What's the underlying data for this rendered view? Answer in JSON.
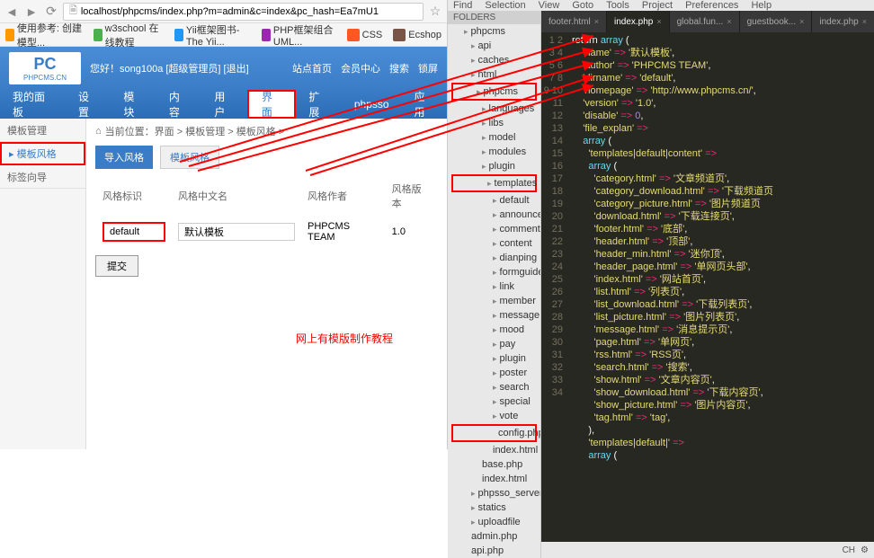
{
  "browser": {
    "url": "localhost/phpcms/index.php?m=admin&c=index&pc_hash=Ea7mU1"
  },
  "bookmarks": [
    {
      "label": "使用参考: 创建模型..."
    },
    {
      "label": "w3school 在线教程"
    },
    {
      "label": "Yii框架图书-The Yii..."
    },
    {
      "label": "PHP框架组合UML..."
    },
    {
      "label": "CSS"
    },
    {
      "label": "Ecshop"
    }
  ],
  "header": {
    "logo_main": "PC",
    "logo_sub": "PHPCMS.CN",
    "welcome": "您好！song100a [超级管理员] [退出]",
    "links": [
      "站点首页",
      "会员中心",
      "搜索",
      "锁屏"
    ]
  },
  "topnav": [
    "我的面板",
    "设置",
    "模块",
    "内容",
    "用户",
    "界面",
    "扩展",
    "phpsso",
    "应用"
  ],
  "sidebar": [
    "模板管理",
    "模板风格",
    "标签向导"
  ],
  "crumb": {
    "icon": "⌂",
    "text": "当前位置：界面 > 模板管理 > 模板风格 >"
  },
  "buttons": {
    "import": "导入风格",
    "style": "模板风格"
  },
  "table": {
    "headers": [
      "风格标识",
      "风格中文名",
      "风格作者",
      "风格版本"
    ],
    "row": {
      "id": "default",
      "name": "默认模板",
      "author": "PHPCMS TEAM",
      "version": "1.0"
    }
  },
  "submit": "提交",
  "tutorial": "网上有模版制作教程",
  "st_menu": [
    "Find",
    "Selection",
    "View",
    "Goto",
    "Tools",
    "Project",
    "Preferences",
    "Help"
  ],
  "st_header": "FOLDERS",
  "tree": [
    {
      "t": "phpcms",
      "d": 0,
      "f": true,
      "r": false
    },
    {
      "t": "api",
      "d": 1,
      "f": true,
      "r": false
    },
    {
      "t": "caches",
      "d": 1,
      "f": true,
      "r": false
    },
    {
      "t": "html",
      "d": 1,
      "f": true,
      "r": false
    },
    {
      "t": "phpcms",
      "d": 1,
      "f": true,
      "r": true
    },
    {
      "t": "languages",
      "d": 2,
      "f": true,
      "r": false
    },
    {
      "t": "libs",
      "d": 2,
      "f": true,
      "r": false
    },
    {
      "t": "model",
      "d": 2,
      "f": true,
      "r": false
    },
    {
      "t": "modules",
      "d": 2,
      "f": true,
      "r": false
    },
    {
      "t": "plugin",
      "d": 2,
      "f": true,
      "r": false
    },
    {
      "t": "templates",
      "d": 2,
      "f": true,
      "r": true
    },
    {
      "t": "default",
      "d": 3,
      "f": true,
      "r": false
    },
    {
      "t": "announce",
      "d": 3,
      "f": true,
      "r": false
    },
    {
      "t": "comment",
      "d": 3,
      "f": true,
      "r": false
    },
    {
      "t": "content",
      "d": 3,
      "f": true,
      "r": false
    },
    {
      "t": "dianping",
      "d": 3,
      "f": true,
      "r": false
    },
    {
      "t": "formguide",
      "d": 3,
      "f": true,
      "r": false
    },
    {
      "t": "link",
      "d": 3,
      "f": true,
      "r": false
    },
    {
      "t": "member",
      "d": 3,
      "f": true,
      "r": false
    },
    {
      "t": "message",
      "d": 3,
      "f": true,
      "r": false
    },
    {
      "t": "mood",
      "d": 3,
      "f": true,
      "r": false
    },
    {
      "t": "pay",
      "d": 3,
      "f": true,
      "r": false
    },
    {
      "t": "plugin",
      "d": 3,
      "f": true,
      "r": false
    },
    {
      "t": "poster",
      "d": 3,
      "f": true,
      "r": false
    },
    {
      "t": "search",
      "d": 3,
      "f": true,
      "r": false
    },
    {
      "t": "special",
      "d": 3,
      "f": true,
      "r": false
    },
    {
      "t": "vote",
      "d": 3,
      "f": true,
      "r": false
    },
    {
      "t": "config.php",
      "d": 3,
      "f": false,
      "r": true
    },
    {
      "t": "index.html",
      "d": 3,
      "f": false,
      "r": false
    },
    {
      "t": "base.php",
      "d": 2,
      "f": false,
      "r": false
    },
    {
      "t": "index.html",
      "d": 2,
      "f": false,
      "r": false
    },
    {
      "t": "phpsso_server",
      "d": 1,
      "f": true,
      "r": false
    },
    {
      "t": "statics",
      "d": 1,
      "f": true,
      "r": false
    },
    {
      "t": "uploadfile",
      "d": 1,
      "f": true,
      "r": false
    },
    {
      "t": "admin.php",
      "d": 1,
      "f": false,
      "r": false
    },
    {
      "t": "api.php",
      "d": 1,
      "f": false,
      "r": false
    }
  ],
  "tabs": [
    "footer.html",
    "index.php",
    "global.fun...",
    "guestbook...",
    "index.php"
  ],
  "code_lines": [
    "<?php <r>return</r> <k>array</k> (",
    "    <s>'name'</s> <o>=></o> <s>'默认模板'</s>,",
    "    <s>'author'</s> <o>=></o> <s>'PHPCMS TEAM'</s>,",
    "    <s>'dirname'</s> <o>=></o> <s>'default'</s>,",
    "    <s>'homepage'</s> <o>=></o> <s>'http://www.phpcms.cn/'</s>,",
    "    <s>'version'</s> <o>=></o> <s>'1.0'</s>,",
    "    <s>'disable'</s> <o>=></o> <c>0</c>,",
    "    <s>'file_explan'</s> <o>=></o>",
    "    <k>array</k> (",
    "      <s>'templates|default|content'</s> <o>=></o>",
    "      <k>array</k> (",
    "        <s>'category.html'</s> <o>=></o> <s>'文章频道页'</s>,",
    "        <s>'category_download.html'</s> <o>=></o> <s>'下载频道页</s>",
    "        <s>'category_picture.html'</s> <o>=></o> <s>'图片频道页</s>",
    "        <s>'download.html'</s> <o>=></o> <s>'下载连接页'</s>,",
    "        <s>'footer.html'</s> <o>=></o> <s>'底部'</s>,",
    "        <s>'header.html'</s> <o>=></o> <s>'顶部'</s>,",
    "        <s>'header_min.html'</s> <o>=></o> <s>'迷你顶'</s>,",
    "        <s>'header_page.html'</s> <o>=></o> <s>'单网页头部'</s>,",
    "        <s>'index.html'</s> <o>=></o> <s>'网站首页'</s>,",
    "        <s>'list.html'</s> <o>=></o> <s>'列表页'</s>,",
    "        <s>'list_download.html'</s> <o>=></o> <s>'下载列表页'</s>,",
    "        <s>'list_picture.html'</s> <o>=></o> <s>'图片列表页'</s>,",
    "        <s>'message.html'</s> <o>=></o> <s>'消息提示页'</s>,",
    "        <s>'page.html'</s> <o>=></o> <s>'单网页'</s>,",
    "        <s>'rss.html'</s> <o>=></o> <s>'RSS页'</s>,",
    "        <s>'search.html'</s> <o>=></o> <s>'搜索'</s>,",
    "        <s>'show.html'</s> <o>=></o> <s>'文章内容页'</s>,",
    "        <s>'show_download.html'</s> <o>=></o> <s>'下载内容页'</s>,",
    "        <s>'show_picture.html'</s> <o>=></o> <s>'图片内容页'</s>,",
    "        <s>'tag.html'</s> <o>=></o> <s>'tag'</s>,",
    "      ),",
    "      <s>'templates|default|'</s> <o>=></o>",
    "      <k>array</k> ("
  ],
  "status": {
    "lang": "CH"
  }
}
